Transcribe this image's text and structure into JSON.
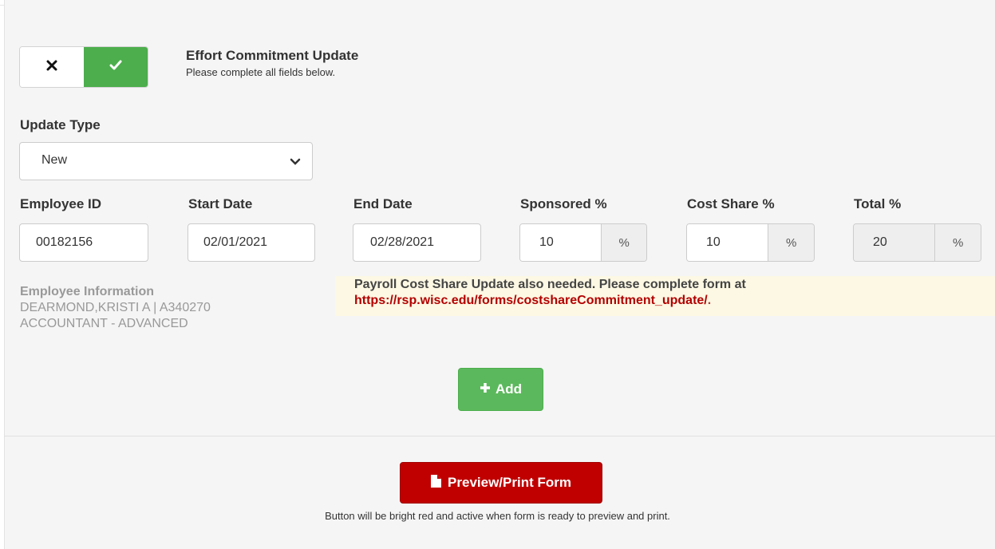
{
  "header": {
    "title": "Effort Commitment Update",
    "subtitle": "Please complete all fields below."
  },
  "toggle": {
    "off_icon": "close-icon",
    "on_icon": "check-icon",
    "state": "on",
    "on_color": "#4cae4c"
  },
  "form": {
    "update_type": {
      "label": "Update Type",
      "value": "New"
    },
    "employee_id": {
      "label": "Employee ID",
      "value": "00182156"
    },
    "start_date": {
      "label": "Start Date",
      "value": "02/01/2021"
    },
    "end_date": {
      "label": "End Date",
      "value": "02/28/2021"
    },
    "sponsored": {
      "label": "Sponsored %",
      "value": "10",
      "unit": "%"
    },
    "cost_share": {
      "label": "Cost Share %",
      "value": "10",
      "unit": "%"
    },
    "total": {
      "label": "Total %",
      "value": "20",
      "unit": "%"
    }
  },
  "employee_info": {
    "heading": "Employee Information",
    "name_line": "DEARMOND,KRISTI A | A340270",
    "title_line": "ACCOUNTANT - ADVANCED"
  },
  "alert": {
    "message": "Payroll Cost Share Update also needed. Please complete form at",
    "link": "https://rsp.wisc.edu/forms/costshareCommitment_update/",
    "suffix": "."
  },
  "actions": {
    "add_label": "Add",
    "add_color": "#5cb85c",
    "print_label": "Preview/Print Form",
    "print_color": "#c00000",
    "print_hint": "Button will be bright red and active when form is ready to preview and print."
  }
}
